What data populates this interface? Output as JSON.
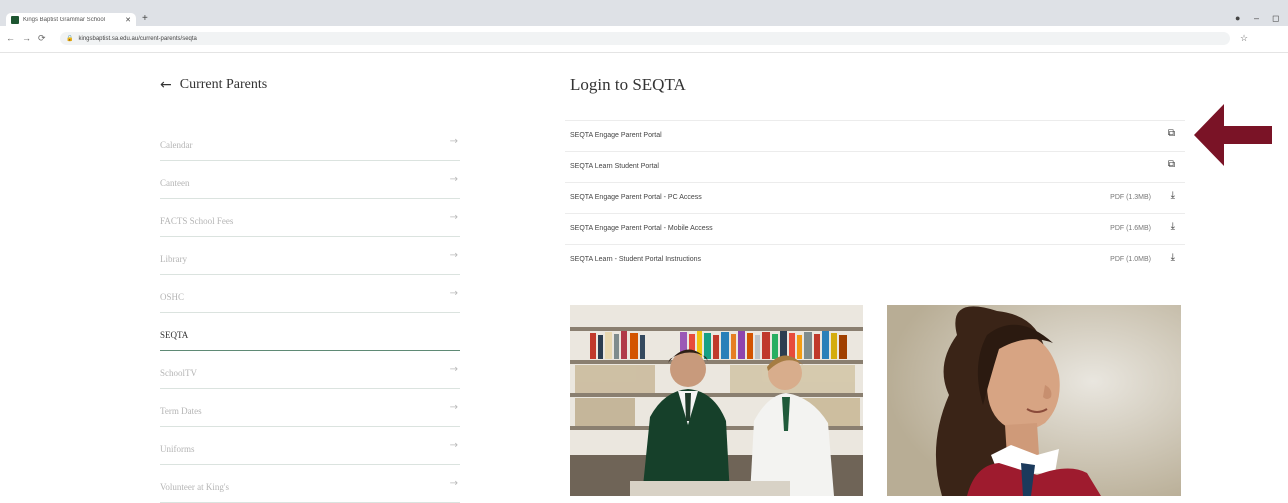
{
  "browser": {
    "tab_title": "Kings Baptist Grammar School",
    "tab_close": "✕",
    "new_tab": "+",
    "url": "kingsbaptist.sa.edu.au/current-parents/seqta",
    "back": "←",
    "forward": "→",
    "reload": "⟳",
    "lock": "🔒",
    "star": "☆",
    "window_controls": [
      "●",
      "–",
      "◻"
    ]
  },
  "sidebar": {
    "back_label": "Current Parents",
    "items": [
      {
        "label": "Calendar"
      },
      {
        "label": "Canteen"
      },
      {
        "label": "FACTS School Fees"
      },
      {
        "label": "Library"
      },
      {
        "label": "OSHC"
      },
      {
        "label": "SEQTA"
      },
      {
        "label": "SchoolTV"
      },
      {
        "label": "Term Dates"
      },
      {
        "label": "Uniforms"
      },
      {
        "label": "Volunteer at King's"
      }
    ],
    "arrow": "→"
  },
  "main": {
    "title": "Login to SEQTA",
    "rows": [
      {
        "name": "SEQTA Engage Parent Portal",
        "size": "",
        "icon": "⧉"
      },
      {
        "name": "SEQTA Learn Student Portal",
        "size": "",
        "icon": "⧉"
      },
      {
        "name": "SEQTA Engage Parent Portal - PC Access",
        "size": "PDF (1.3MB)",
        "icon": "⤓"
      },
      {
        "name": "SEQTA Engage Parent Portal - Mobile Access",
        "size": "PDF (1.6MB)",
        "icon": "⤓"
      },
      {
        "name": "SEQTA Learn - Student Portal Instructions",
        "size": "PDF (1.0MB)",
        "icon": "⤓"
      }
    ]
  },
  "colors": {
    "annotation_arrow": "#7a1326",
    "active_underline": "#5f8a75",
    "blazer_green": "#16402a",
    "blazer_red": "#9e1b2e"
  }
}
